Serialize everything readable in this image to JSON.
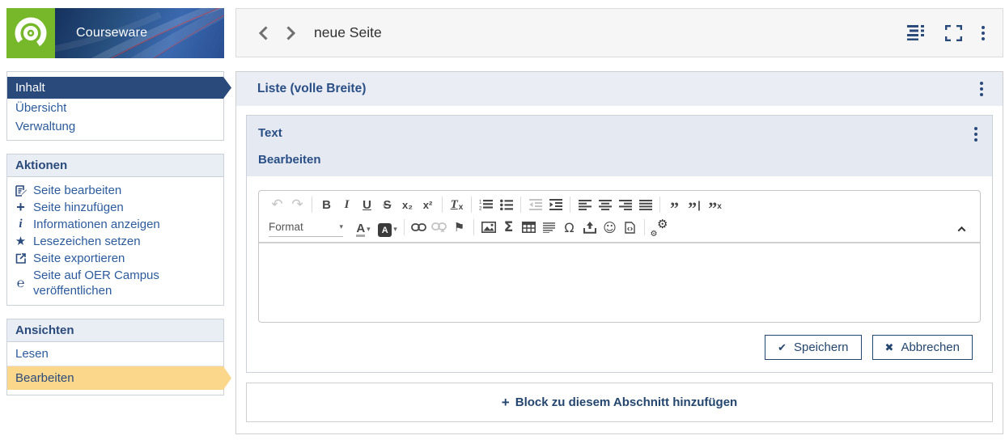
{
  "colors": {
    "accent_navy": "#2a4a7c",
    "link_blue": "#2b5b9c",
    "highlight_yellow": "#fbd78b",
    "brand_green": "#76b82a",
    "banner_blue": "#2a529b",
    "block_header_bg": "#e4e9f2"
  },
  "brand": {
    "name": "Courseware"
  },
  "sidebar": {
    "nav": {
      "items": [
        {
          "label": "Inhalt",
          "active": true
        },
        {
          "label": "Übersicht",
          "active": false
        },
        {
          "label": "Verwaltung",
          "active": false
        }
      ]
    },
    "actions": {
      "title": "Aktionen",
      "items": [
        {
          "label": "Seite bearbeiten",
          "icon": "edit-page-icon"
        },
        {
          "label": "Seite hinzufügen",
          "icon": "plus-icon",
          "glyph": "+"
        },
        {
          "label": "Informationen anzeigen",
          "icon": "info-icon",
          "glyph": "i"
        },
        {
          "label": "Lesezeichen setzen",
          "icon": "star-icon",
          "glyph": "★"
        },
        {
          "label": "Seite exportieren",
          "icon": "export-icon"
        },
        {
          "label": "Seite auf OER Campus veröffentlichen",
          "icon": "publish-icon",
          "glyph": "℮"
        }
      ]
    },
    "views": {
      "title": "Ansichten",
      "items": [
        {
          "label": "Lesen",
          "active": false
        },
        {
          "label": "Bearbeiten",
          "active": true
        }
      ]
    }
  },
  "header": {
    "title": "neue Seite"
  },
  "section": {
    "title": "Liste (volle Breite)"
  },
  "block": {
    "title": "Text",
    "tab": "Bearbeiten",
    "toolbar": {
      "format_label": "Format",
      "caret": "▾",
      "undo": "↶",
      "redo": "↷",
      "bold": "B",
      "italic": "I",
      "underline": "U",
      "strike": "S",
      "subscript": "x₂",
      "superscript": "x²",
      "remove_format_base": "T",
      "remove_format_sub": "x",
      "text_color_letter": "A",
      "bg_color_letter": "A",
      "flag": "⚑",
      "sigma": "Σ",
      "omega": "Ω",
      "smiley": "☺",
      "gear": "⚙",
      "quote": "”",
      "quote_bar": "|",
      "quote_x": "x"
    },
    "buttons": {
      "save": "Speichern",
      "save_glyph": "✔",
      "cancel": "Abbrechen",
      "cancel_glyph": "✖"
    }
  },
  "add_block": {
    "plus": "+",
    "label": "Block zu diesem Abschnitt hinzufügen"
  }
}
